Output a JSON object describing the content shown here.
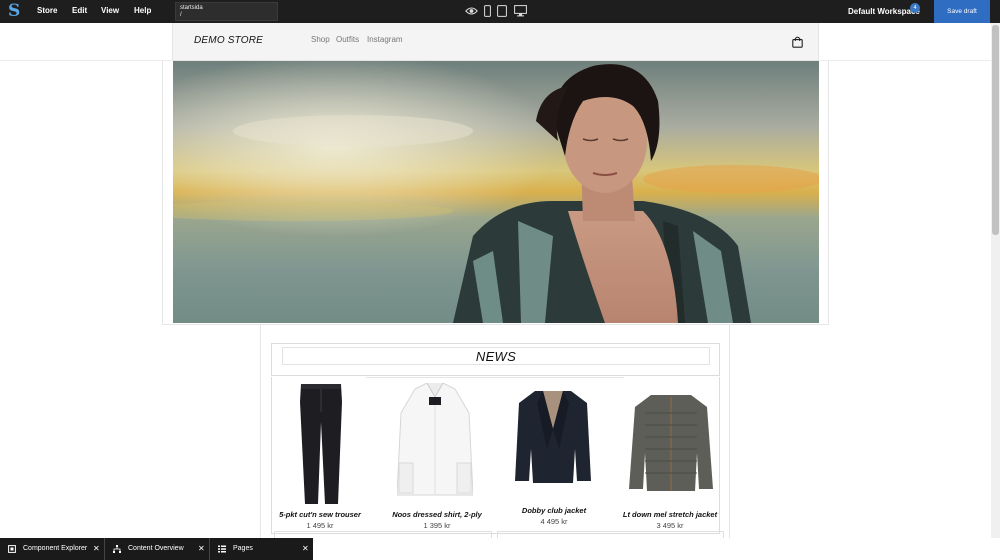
{
  "topbar": {
    "logo": "S",
    "menu": [
      "Store",
      "Edit",
      "View",
      "Help"
    ],
    "page_name": "startsida",
    "page_path": "/",
    "view_icons": [
      "preview-eye-icon",
      "mobile-view-icon",
      "tablet-view-icon",
      "desktop-view-icon"
    ],
    "workspace": "Default Workspace",
    "workspace_count": "4",
    "save_label": "Save draft",
    "accent": "#2f6dc3"
  },
  "store": {
    "name": "DEMO STORE",
    "nav": [
      "Shop",
      "Outfits",
      "Instagram"
    ],
    "cart_icon": "shopping-bag-icon"
  },
  "news": {
    "title": "NEWS",
    "products": [
      {
        "name": "5-pkt cut'n sew trouser",
        "price": "1 495 kr"
      },
      {
        "name": "Noos dressed shirt, 2-ply",
        "price": "1 395 kr"
      },
      {
        "name": "Dobby club jacket",
        "price": "4 495 kr"
      },
      {
        "name": "Lt down mel stretch jacket",
        "price": "3 495 kr"
      }
    ]
  },
  "panels": [
    {
      "label": "Component Explorer",
      "icon": "component-icon"
    },
    {
      "label": "Content Overview",
      "icon": "hierarchy-icon"
    },
    {
      "label": "Pages",
      "icon": "pages-list-icon"
    }
  ]
}
